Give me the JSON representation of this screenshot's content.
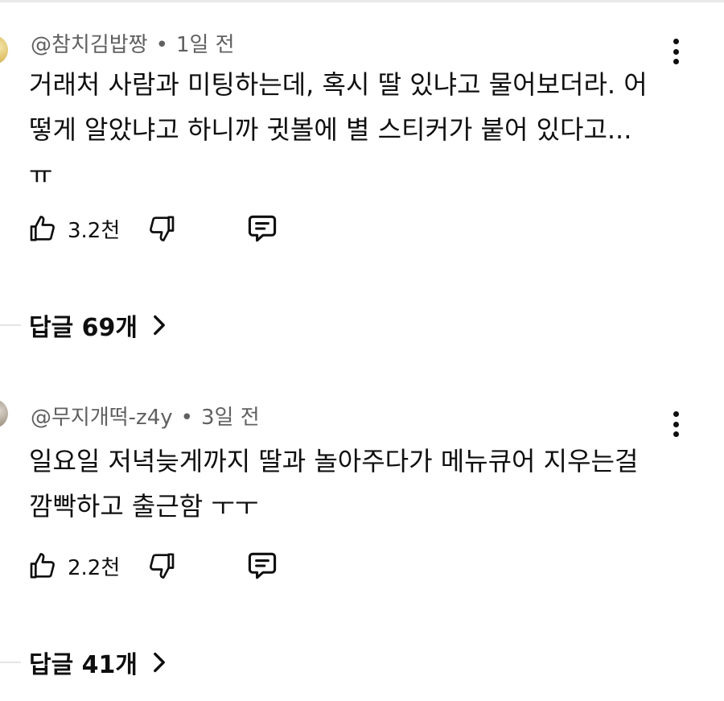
{
  "comments": [
    {
      "author": "@참치김밥짱",
      "separator": "•",
      "time": "1일 전",
      "lines": [
        "거래처 사람과 미팅하는데, 혹시 딸 있냐고 물어보더라. 어",
        "떻게 알았냐고 하니까 귓볼에 별 스티커가 붙어 있다고...",
        "ㅠ"
      ],
      "likes": "3.2천",
      "replies_label": "답글 69개"
    },
    {
      "author": "@무지개떡-z4y",
      "separator": "•",
      "time": "3일 전",
      "lines": [
        "일요일 저녁늦게까지 딸과 놀아주다가 메뉴큐어 지우는걸",
        "깜빡하고 출근함 ㅜㅜ"
      ],
      "likes": "2.2천",
      "replies_label": "답글 41개"
    }
  ],
  "icons": {
    "like": "thumbs-up-icon",
    "dislike": "thumbs-down-icon",
    "reply": "reply-comment-icon",
    "more": "more-vertical-icon",
    "chevron": "chevron-right-icon"
  }
}
